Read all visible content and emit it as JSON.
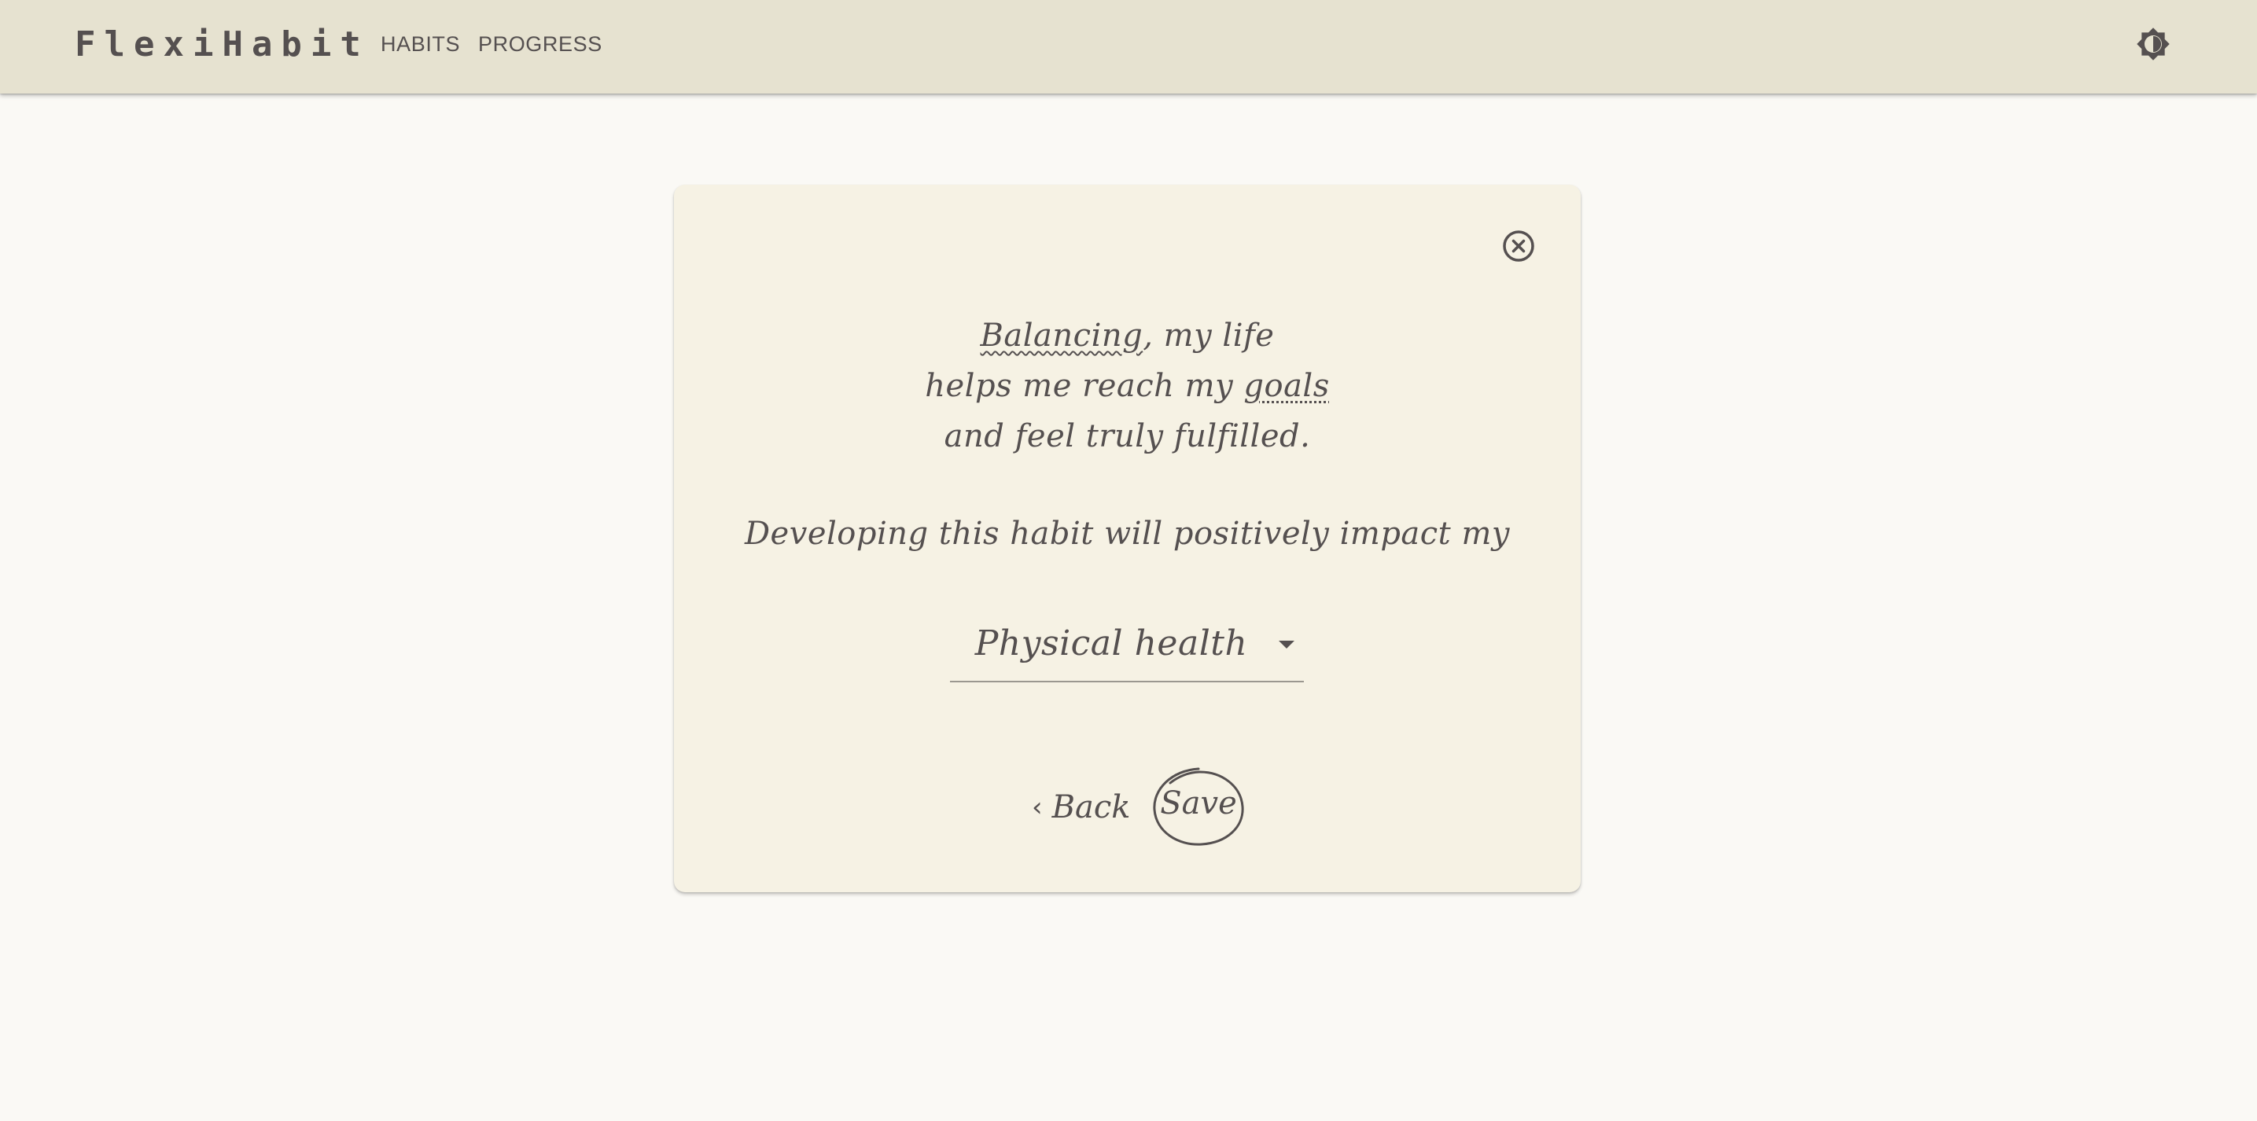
{
  "app": {
    "title": "FlexiHabit"
  },
  "nav": {
    "habits_label": "HABITS",
    "progress_label": "PROGRESS"
  },
  "icons": {
    "theme_toggle": "brightness-icon",
    "close": "close-circle-icon",
    "back": "chevron-left-icon",
    "dropdown": "caret-down-icon"
  },
  "card": {
    "quote": {
      "line1_pre": "",
      "line1_squiggle": "Balancing",
      "line1_post": ", my life",
      "line2_pre": "helps me reach my ",
      "line2_dotted": "goals",
      "line3": "and feel truly fulfilled."
    },
    "impact_prompt": "Developing this habit will positively impact my",
    "impact_select": {
      "selected": "Physical health"
    },
    "back_label": "Back",
    "save_label": "Save"
  },
  "colors": {
    "appbar_bg": "#e6e2d0",
    "page_bg": "#faf9f5",
    "card_bg": "#f6f2e4",
    "text": "#555050"
  }
}
